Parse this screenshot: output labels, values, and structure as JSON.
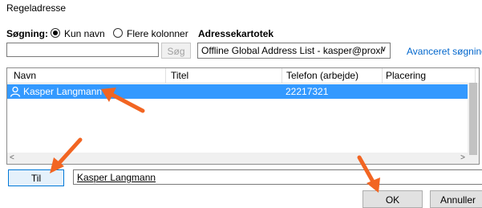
{
  "dialog": {
    "title": "Regeladresse"
  },
  "search": {
    "label": "Søgning:",
    "option_name": "Kun navn",
    "option_columns": "Flere kolonner",
    "input_value": "",
    "button": "Søg"
  },
  "address_book": {
    "label": "Adressekartotek",
    "selected": "Offline Global Address List - kasper@proxi"
  },
  "advanced_link": "Avanceret søgning",
  "list": {
    "columns": [
      "Navn",
      "Titel",
      "Telefon (arbejde)",
      "Placering"
    ],
    "rows": [
      {
        "name": "Kasper Langmann",
        "title": "",
        "phone": "22217321",
        "location": ""
      }
    ]
  },
  "to": {
    "button": "Til",
    "value": "Kasper Langmann"
  },
  "footer": {
    "ok": "OK",
    "cancel": "Annuller"
  },
  "colors": {
    "selection": "#3399ff",
    "link": "#0066cc",
    "annotation_arrow": "#f26522"
  }
}
